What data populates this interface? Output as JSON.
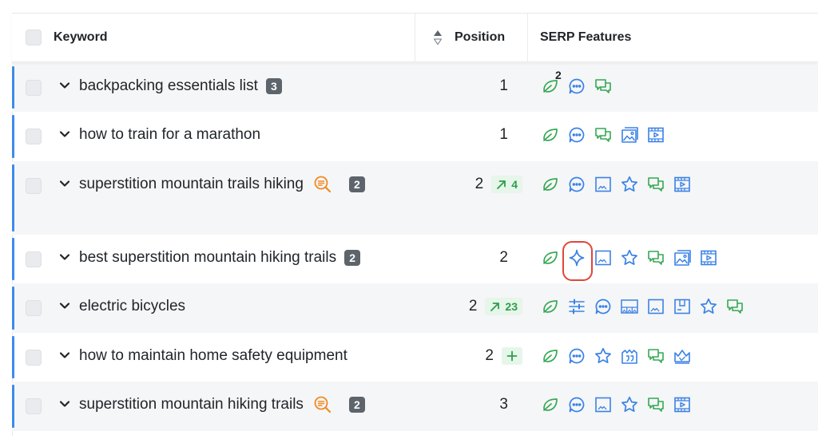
{
  "header": {
    "keyword_label": "Keyword",
    "position_label": "Position",
    "serp_label": "SERP Features"
  },
  "colors": {
    "accent": "#3d8bea",
    "green": "#35a853",
    "blue": "#3b82e6",
    "orange": "#f08a24",
    "highlight": "#e0463a"
  },
  "rows": [
    {
      "keyword": "backpacking essentials list",
      "count": "3",
      "position": "1",
      "features": [
        "featured-snippet-icon",
        "people-also-ask-icon",
        "reviews-icon"
      ],
      "featured_snippet_count": "2"
    },
    {
      "keyword": "how to train for a marathon",
      "position": "1",
      "features": [
        "featured-snippet-icon",
        "people-also-ask-icon",
        "reviews-icon",
        "images-icon",
        "video-icon"
      ]
    },
    {
      "keyword": "superstition mountain trails hiking",
      "count": "2",
      "has_ai_icon": true,
      "position": "2",
      "change": "4",
      "features": [
        "featured-snippet-icon",
        "people-also-ask-icon",
        "image-pack-icon",
        "star-icon",
        "reviews-icon",
        "video-icon"
      ]
    },
    {
      "keyword": "best superstition mountain hiking trails",
      "count": "2",
      "position": "2",
      "features": [
        "featured-snippet-icon",
        "ai-overview-icon",
        "image-pack-icon",
        "star-icon",
        "reviews-icon",
        "images-icon",
        "video-icon"
      ],
      "highlighted_feature": "ai-overview-icon"
    },
    {
      "keyword": "electric bicycles",
      "position": "2",
      "change": "23",
      "features": [
        "featured-snippet-icon",
        "filters-icon",
        "people-also-ask-icon",
        "image-carousel-icon",
        "image-pack-icon",
        "shopping-icon",
        "star-icon",
        "reviews-icon"
      ]
    },
    {
      "keyword": "how to maintain home safety equipment",
      "position": "2",
      "is_new": true,
      "features": [
        "featured-snippet-icon",
        "people-also-ask-icon",
        "star-icon",
        "quote-icon",
        "reviews-icon",
        "top-stories-icon"
      ]
    },
    {
      "keyword": "superstition mountain hiking trails",
      "count": "2",
      "has_ai_icon": true,
      "position": "3",
      "features": [
        "featured-snippet-icon",
        "people-also-ask-icon",
        "image-pack-icon",
        "star-icon",
        "reviews-icon",
        "video-icon"
      ]
    }
  ]
}
